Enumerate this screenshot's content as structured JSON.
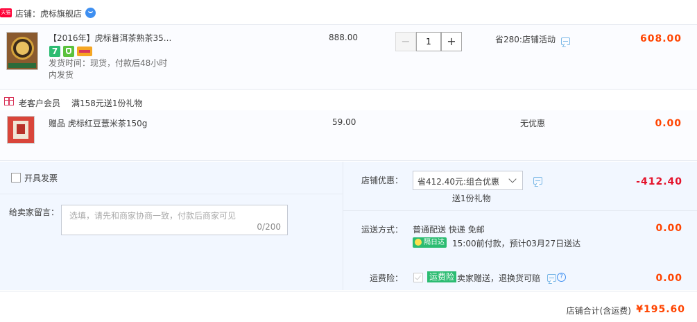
{
  "shop": {
    "badge": "天猫",
    "name": "店铺：虎标旗舰店"
  },
  "item1": {
    "title": "【2016年】虎标普洱茶熟茶35...",
    "ship_time": "发货时间：现货，付款后48小时内发货",
    "unit_price": "888.00",
    "quantity": "1",
    "qty_minus": "−",
    "qty_plus": "+",
    "discount": "省280:店铺活动",
    "total": "608.00",
    "badge_seven": "7"
  },
  "promo": {
    "member": "老客户会员",
    "offer": "满158元送1份礼物"
  },
  "item2": {
    "title": "赠品 虎标红豆薏米茶150g",
    "unit_price": "59.00",
    "discount": "无优惠",
    "total": "0.00"
  },
  "invoice": {
    "label": "开具发票"
  },
  "message": {
    "label": "给卖家留言：",
    "placeholder": "选填，请先和商家协商一致，付款后商家可见",
    "counter": "0/200"
  },
  "shop_discount": {
    "label": "店铺优惠：",
    "selected": "省412.40元:组合优惠",
    "gift": "送1份礼物",
    "amount": "-412.40"
  },
  "shipping": {
    "label": "运送方式：",
    "method": "普通配送 快递 免邮",
    "badge": "隔日达",
    "eta": "15:00前付款，预计03月27日送达",
    "amount": "0.00"
  },
  "insurance": {
    "label": "运费险：",
    "tag": "运费险",
    "text": "卖家赠送，退换货可赔",
    "amount": "0.00"
  },
  "total": {
    "label": "店铺合计(含运费)",
    "value": "¥195.60"
  },
  "colors": {
    "accent": "#ff4400",
    "negative": "#e4122a",
    "tmall": "#ff0036",
    "green": "#2cbc72",
    "link_blue": "#3e8ff1"
  }
}
